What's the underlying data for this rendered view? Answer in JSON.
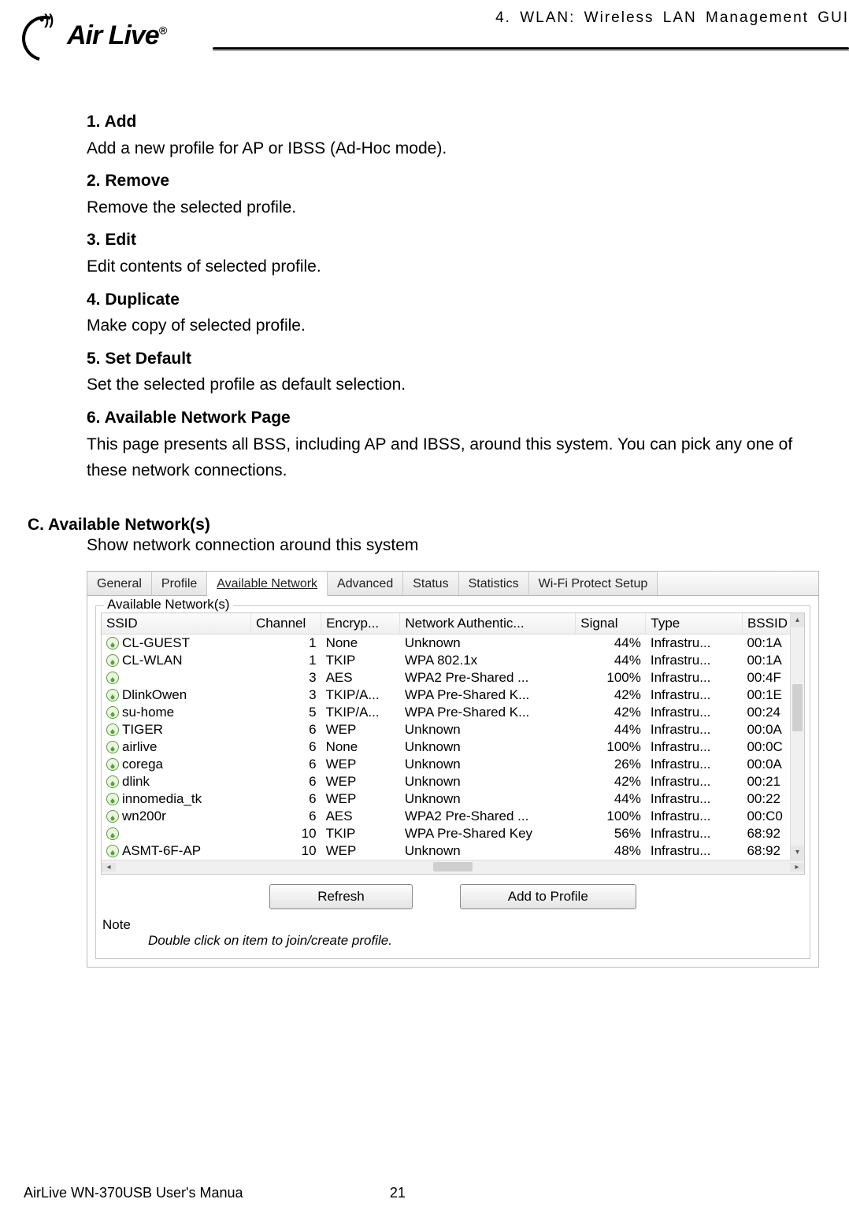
{
  "chapter_title": "4. WLAN: Wireless LAN Management GUI",
  "logo_text": "Air Live",
  "logo_reg": "®",
  "items": [
    {
      "title": "1. Add",
      "desc": "Add a new profile for AP or IBSS (Ad-Hoc mode)."
    },
    {
      "title": "2. Remove",
      "desc": "Remove the selected profile."
    },
    {
      "title": "3. Edit",
      "desc": "Edit contents of selected profile."
    },
    {
      "title": "4. Duplicate",
      "desc": "Make copy of selected profile."
    },
    {
      "title": "5. Set Default",
      "desc": "Set the selected profile as default selection."
    },
    {
      "title": "6. Available Network Page",
      "desc": "This page presents all BSS, including AP and IBSS, around this system. You can pick any one of these network connections."
    }
  ],
  "section_c": {
    "title": "C. Available Network(s)",
    "desc": "Show network connection around this system"
  },
  "tabs": [
    "General",
    "Profile",
    "Available Network",
    "Advanced",
    "Status",
    "Statistics",
    "Wi-Fi Protect Setup"
  ],
  "active_tab": 2,
  "group_label": "Available Network(s)",
  "headers": [
    "SSID",
    "Channel",
    "Encryp...",
    "Network Authentic...",
    "Signal",
    "Type",
    "BSSID"
  ],
  "rows": [
    {
      "ssid": "CL-GUEST",
      "channel": "1",
      "enc": "None",
      "auth": "Unknown",
      "signal": "44%",
      "type": "Infrastru...",
      "bssid": "00:1A"
    },
    {
      "ssid": "CL-WLAN",
      "channel": "1",
      "enc": "TKIP",
      "auth": "WPA 802.1x",
      "signal": "44%",
      "type": "Infrastru...",
      "bssid": "00:1A"
    },
    {
      "ssid": "",
      "channel": "3",
      "enc": "AES",
      "auth": "WPA2 Pre-Shared ...",
      "signal": "100%",
      "type": "Infrastru...",
      "bssid": "00:4F"
    },
    {
      "ssid": "DlinkOwen",
      "channel": "3",
      "enc": "TKIP/A...",
      "auth": "WPA Pre-Shared K...",
      "signal": "42%",
      "type": "Infrastru...",
      "bssid": "00:1E"
    },
    {
      "ssid": "su-home",
      "channel": "5",
      "enc": "TKIP/A...",
      "auth": "WPA Pre-Shared K...",
      "signal": "42%",
      "type": "Infrastru...",
      "bssid": "00:24"
    },
    {
      "ssid": "TIGER",
      "channel": "6",
      "enc": "WEP",
      "auth": "Unknown",
      "signal": "44%",
      "type": "Infrastru...",
      "bssid": "00:0A"
    },
    {
      "ssid": "airlive",
      "channel": "6",
      "enc": "None",
      "auth": "Unknown",
      "signal": "100%",
      "type": "Infrastru...",
      "bssid": "00:0C"
    },
    {
      "ssid": "corega",
      "channel": "6",
      "enc": "WEP",
      "auth": "Unknown",
      "signal": "26%",
      "type": "Infrastru...",
      "bssid": "00:0A"
    },
    {
      "ssid": "dlink",
      "channel": "6",
      "enc": "WEP",
      "auth": "Unknown",
      "signal": "42%",
      "type": "Infrastru...",
      "bssid": "00:21"
    },
    {
      "ssid": "innomedia_tk",
      "channel": "6",
      "enc": "WEP",
      "auth": "Unknown",
      "signal": "44%",
      "type": "Infrastru...",
      "bssid": "00:22"
    },
    {
      "ssid": "wn200r",
      "channel": "6",
      "enc": "AES",
      "auth": "WPA2 Pre-Shared ...",
      "signal": "100%",
      "type": "Infrastru...",
      "bssid": "00:C0"
    },
    {
      "ssid": "",
      "channel": "10",
      "enc": "TKIP",
      "auth": "WPA Pre-Shared Key",
      "signal": "56%",
      "type": "Infrastru...",
      "bssid": "68:92"
    },
    {
      "ssid": "ASMT-6F-AP",
      "channel": "10",
      "enc": "WEP",
      "auth": "Unknown",
      "signal": "48%",
      "type": "Infrastru...",
      "bssid": "68:92"
    }
  ],
  "buttons": {
    "refresh": "Refresh",
    "add_profile": "Add to Profile"
  },
  "note_label": "Note",
  "note_text": "Double click on item to join/create profile.",
  "footer": {
    "manual": "AirLive WN-370USB User's Manua",
    "page": "21"
  }
}
